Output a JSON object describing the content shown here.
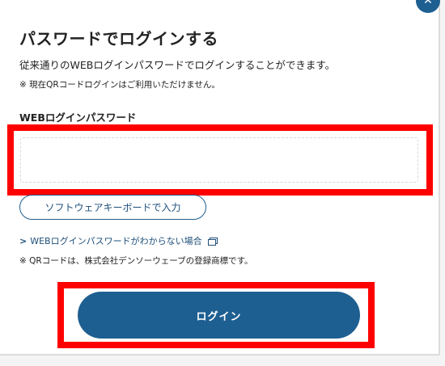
{
  "dialog": {
    "title": "パスワードでログインする",
    "description": "従来通りのWEBログインパスワードでログインすることができます。",
    "note_qr_unavailable": "※ 現在QRコードログインはご利用いただけません。",
    "close_symbol": "✕"
  },
  "password_field": {
    "label": "WEBログインパスワード",
    "value": "",
    "placeholder": ""
  },
  "software_keyboard_button": {
    "label": "ソフトウェアキーボードで入力"
  },
  "forgot_password_link": {
    "label": "WEBログインパスワードがわからない場合"
  },
  "trademark_note": "※ QRコードは、株式会社デンソーウェーブの登録商標です。",
  "login_button": {
    "label": "ログイン"
  },
  "colors": {
    "accent": "#1e5f91",
    "highlight_frame": "#ff0000"
  }
}
